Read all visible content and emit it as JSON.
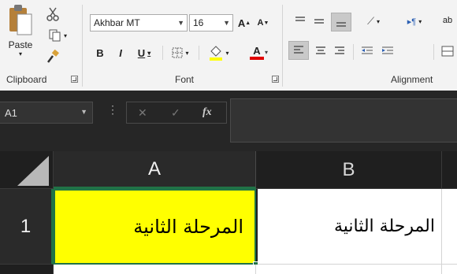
{
  "clipboard": {
    "paste_label": "Paste",
    "group_label": "Clipboard"
  },
  "font": {
    "name": "Akhbar MT",
    "size": "16",
    "bold": "B",
    "italic": "I",
    "underline": "U",
    "group_label": "Font",
    "grow": "A",
    "shrink": "A",
    "color_a": "A"
  },
  "alignment": {
    "group_label": "Alignment",
    "wrap_hint": "ab"
  },
  "formula_bar": {
    "name_box": "A1",
    "fx": "fx",
    "cancel": "✕",
    "enter": "✓",
    "formula": ""
  },
  "grid": {
    "columns": [
      "A",
      "B"
    ],
    "rows": [
      "1"
    ],
    "cells": {
      "A1": "المرحلة الثانية",
      "B1": "المرحلة الثانية"
    }
  },
  "colors": {
    "highlight_yellow": "#ffff00",
    "font_red": "#e00000",
    "selection_green": "#217346"
  }
}
